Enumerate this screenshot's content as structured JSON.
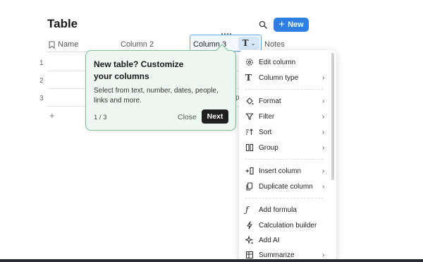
{
  "page": {
    "title": "Table",
    "new_button_label": "New",
    "search_icon": "search-icon",
    "new_button_icon": "plus-icon",
    "accent_color": "#2f7fe0"
  },
  "table": {
    "columns": [
      {
        "label": "Name",
        "icon": "bookmark-icon"
      },
      {
        "label": "Column 2"
      },
      {
        "label": "Column 3",
        "selected": true,
        "type_icon": "text-type-icon"
      },
      {
        "label": "Notes"
      }
    ],
    "rows": [
      "1",
      "2",
      "3"
    ],
    "add_row_label": "+",
    "peek_text": "p"
  },
  "tooltip": {
    "title": "New table? Customize your columns",
    "body": "Select from text, number, dates, people, links and more.",
    "step": "1 / 3",
    "close_label": "Close",
    "next_label": "Next",
    "background": "#edf8f2",
    "border": "#7fbf99"
  },
  "menu": {
    "items": [
      {
        "label": "Edit column",
        "icon": "gear-icon",
        "submenu": false
      },
      {
        "label": "Column type",
        "icon": "text-type-icon",
        "submenu": true
      },
      {
        "label": "Format",
        "icon": "paint-bucket-icon",
        "submenu": true
      },
      {
        "label": "Filter",
        "icon": "filter-icon",
        "submenu": true
      },
      {
        "label": "Sort",
        "icon": "sort-icon",
        "submenu": true
      },
      {
        "label": "Group",
        "icon": "group-icon",
        "submenu": true
      },
      {
        "label": "Insert column",
        "icon": "insert-column-icon",
        "submenu": true
      },
      {
        "label": "Duplicate column",
        "icon": "duplicate-icon",
        "submenu": true
      },
      {
        "label": "Add formula",
        "icon": "formula-icon",
        "submenu": false
      },
      {
        "label": "Calculation builder",
        "icon": "lightning-icon",
        "submenu": false
      },
      {
        "label": "Add AI",
        "icon": "sparkle-icon",
        "submenu": false
      },
      {
        "label": "Summarize",
        "icon": "summarize-icon",
        "submenu": true
      }
    ]
  }
}
